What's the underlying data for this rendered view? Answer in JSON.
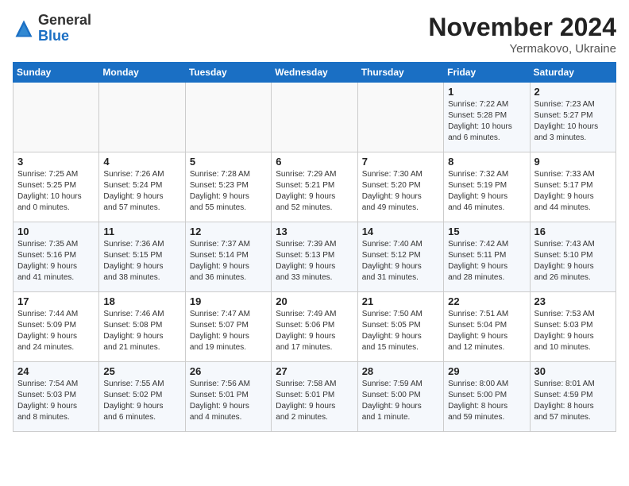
{
  "header": {
    "logo_general": "General",
    "logo_blue": "Blue",
    "month_title": "November 2024",
    "subtitle": "Yermakovo, Ukraine"
  },
  "weekdays": [
    "Sunday",
    "Monday",
    "Tuesday",
    "Wednesday",
    "Thursday",
    "Friday",
    "Saturday"
  ],
  "weeks": [
    [
      {
        "day": "",
        "detail": ""
      },
      {
        "day": "",
        "detail": ""
      },
      {
        "day": "",
        "detail": ""
      },
      {
        "day": "",
        "detail": ""
      },
      {
        "day": "",
        "detail": ""
      },
      {
        "day": "1",
        "detail": "Sunrise: 7:22 AM\nSunset: 5:28 PM\nDaylight: 10 hours\nand 6 minutes."
      },
      {
        "day": "2",
        "detail": "Sunrise: 7:23 AM\nSunset: 5:27 PM\nDaylight: 10 hours\nand 3 minutes."
      }
    ],
    [
      {
        "day": "3",
        "detail": "Sunrise: 7:25 AM\nSunset: 5:25 PM\nDaylight: 10 hours\nand 0 minutes."
      },
      {
        "day": "4",
        "detail": "Sunrise: 7:26 AM\nSunset: 5:24 PM\nDaylight: 9 hours\nand 57 minutes."
      },
      {
        "day": "5",
        "detail": "Sunrise: 7:28 AM\nSunset: 5:23 PM\nDaylight: 9 hours\nand 55 minutes."
      },
      {
        "day": "6",
        "detail": "Sunrise: 7:29 AM\nSunset: 5:21 PM\nDaylight: 9 hours\nand 52 minutes."
      },
      {
        "day": "7",
        "detail": "Sunrise: 7:30 AM\nSunset: 5:20 PM\nDaylight: 9 hours\nand 49 minutes."
      },
      {
        "day": "8",
        "detail": "Sunrise: 7:32 AM\nSunset: 5:19 PM\nDaylight: 9 hours\nand 46 minutes."
      },
      {
        "day": "9",
        "detail": "Sunrise: 7:33 AM\nSunset: 5:17 PM\nDaylight: 9 hours\nand 44 minutes."
      }
    ],
    [
      {
        "day": "10",
        "detail": "Sunrise: 7:35 AM\nSunset: 5:16 PM\nDaylight: 9 hours\nand 41 minutes."
      },
      {
        "day": "11",
        "detail": "Sunrise: 7:36 AM\nSunset: 5:15 PM\nDaylight: 9 hours\nand 38 minutes."
      },
      {
        "day": "12",
        "detail": "Sunrise: 7:37 AM\nSunset: 5:14 PM\nDaylight: 9 hours\nand 36 minutes."
      },
      {
        "day": "13",
        "detail": "Sunrise: 7:39 AM\nSunset: 5:13 PM\nDaylight: 9 hours\nand 33 minutes."
      },
      {
        "day": "14",
        "detail": "Sunrise: 7:40 AM\nSunset: 5:12 PM\nDaylight: 9 hours\nand 31 minutes."
      },
      {
        "day": "15",
        "detail": "Sunrise: 7:42 AM\nSunset: 5:11 PM\nDaylight: 9 hours\nand 28 minutes."
      },
      {
        "day": "16",
        "detail": "Sunrise: 7:43 AM\nSunset: 5:10 PM\nDaylight: 9 hours\nand 26 minutes."
      }
    ],
    [
      {
        "day": "17",
        "detail": "Sunrise: 7:44 AM\nSunset: 5:09 PM\nDaylight: 9 hours\nand 24 minutes."
      },
      {
        "day": "18",
        "detail": "Sunrise: 7:46 AM\nSunset: 5:08 PM\nDaylight: 9 hours\nand 21 minutes."
      },
      {
        "day": "19",
        "detail": "Sunrise: 7:47 AM\nSunset: 5:07 PM\nDaylight: 9 hours\nand 19 minutes."
      },
      {
        "day": "20",
        "detail": "Sunrise: 7:49 AM\nSunset: 5:06 PM\nDaylight: 9 hours\nand 17 minutes."
      },
      {
        "day": "21",
        "detail": "Sunrise: 7:50 AM\nSunset: 5:05 PM\nDaylight: 9 hours\nand 15 minutes."
      },
      {
        "day": "22",
        "detail": "Sunrise: 7:51 AM\nSunset: 5:04 PM\nDaylight: 9 hours\nand 12 minutes."
      },
      {
        "day": "23",
        "detail": "Sunrise: 7:53 AM\nSunset: 5:03 PM\nDaylight: 9 hours\nand 10 minutes."
      }
    ],
    [
      {
        "day": "24",
        "detail": "Sunrise: 7:54 AM\nSunset: 5:03 PM\nDaylight: 9 hours\nand 8 minutes."
      },
      {
        "day": "25",
        "detail": "Sunrise: 7:55 AM\nSunset: 5:02 PM\nDaylight: 9 hours\nand 6 minutes."
      },
      {
        "day": "26",
        "detail": "Sunrise: 7:56 AM\nSunset: 5:01 PM\nDaylight: 9 hours\nand 4 minutes."
      },
      {
        "day": "27",
        "detail": "Sunrise: 7:58 AM\nSunset: 5:01 PM\nDaylight: 9 hours\nand 2 minutes."
      },
      {
        "day": "28",
        "detail": "Sunrise: 7:59 AM\nSunset: 5:00 PM\nDaylight: 9 hours\nand 1 minute."
      },
      {
        "day": "29",
        "detail": "Sunrise: 8:00 AM\nSunset: 5:00 PM\nDaylight: 8 hours\nand 59 minutes."
      },
      {
        "day": "30",
        "detail": "Sunrise: 8:01 AM\nSunset: 4:59 PM\nDaylight: 8 hours\nand 57 minutes."
      }
    ]
  ]
}
